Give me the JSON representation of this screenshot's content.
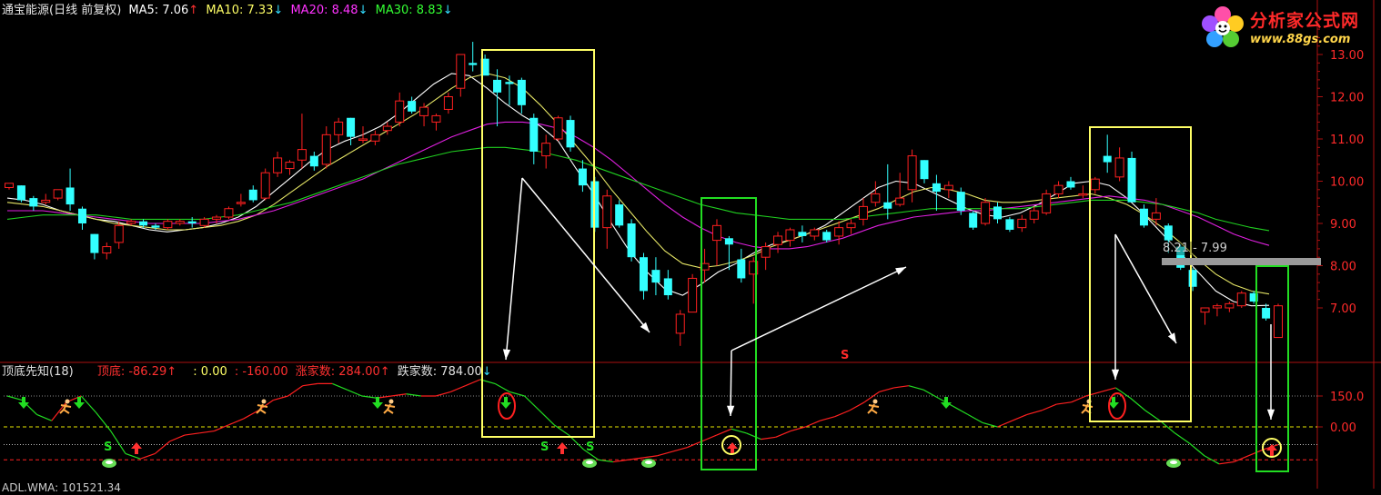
{
  "main_header": {
    "title": "通宝能源(日线 前复权)",
    "ma5": {
      "label": "MA5: 7.06",
      "arrow": "↑",
      "color": "#ffffff",
      "arrow_color": "#ff3030"
    },
    "ma10": {
      "label": "MA10: 7.33",
      "arrow": "↓",
      "color": "#ffff66",
      "arrow_color": "#33ddff"
    },
    "ma20": {
      "label": "MA20: 8.48",
      "arrow": "↓",
      "color": "#ff33ff",
      "arrow_color": "#33ddff"
    },
    "ma30": {
      "label": "MA30: 8.83",
      "arrow": "↓",
      "color": "#33ff33",
      "arrow_color": "#33ddff"
    }
  },
  "logo": {
    "name": "分析家公式网",
    "url": "www.88gs.com"
  },
  "sub_header": {
    "title": "顶底先知(18)",
    "dingdi": {
      "label": "顶底: -86.29",
      "arrow": "↑"
    },
    "v1": ": 0.00",
    "v2": ": -160.00",
    "zhang": {
      "label": "涨家数: 284.00",
      "arrow": "↑"
    },
    "die": {
      "label": "跌家数: 784.00",
      "arrow": "↓"
    }
  },
  "bottom_cut_text": "ADL.WMA: 101521.34",
  "zone_label": "8.21 - 7.99",
  "s_marker": "S",
  "colors": {
    "up": "#ff2020",
    "down": "#33ffff",
    "ma5": "#ffffff",
    "ma10": "#e6e666",
    "ma20": "#e020e0",
    "ma30": "#20d020",
    "yellow_box": "#ffff66",
    "green_box": "#22dd22",
    "axis": "#aa1111"
  },
  "chart_data": [
    {
      "type": "candlestick",
      "title": "通宝能源(日线 前复权)",
      "y_ticks": [
        "7.00",
        "8.00",
        "9.00",
        "10.00",
        "11.00",
        "12.00",
        "13.00"
      ],
      "ylim": [
        6.0,
        13.2
      ],
      "candles": [
        [
          9.85,
          9.95,
          9.8,
          9.95
        ],
        [
          9.9,
          9.9,
          9.5,
          9.55
        ],
        [
          9.6,
          9.65,
          9.3,
          9.4
        ],
        [
          9.5,
          9.7,
          9.45,
          9.55
        ],
        [
          9.6,
          9.8,
          9.55,
          9.8
        ],
        [
          9.85,
          10.3,
          9.3,
          9.45
        ],
        [
          9.35,
          9.4,
          8.85,
          9.0
        ],
        [
          8.75,
          8.75,
          8.15,
          8.3
        ],
        [
          8.3,
          8.55,
          8.15,
          8.45
        ],
        [
          8.55,
          9.05,
          8.4,
          8.95
        ],
        [
          9.0,
          9.1,
          8.95,
          9.05
        ],
        [
          9.05,
          9.1,
          8.9,
          8.95
        ],
        [
          8.95,
          9.0,
          8.85,
          8.9
        ],
        [
          8.9,
          9.1,
          8.85,
          9.05
        ],
        [
          9.0,
          9.1,
          8.95,
          9.05
        ],
        [
          9.05,
          9.15,
          8.9,
          9.0
        ],
        [
          8.95,
          9.15,
          8.9,
          9.1
        ],
        [
          9.1,
          9.2,
          9.0,
          9.15
        ],
        [
          9.15,
          9.4,
          9.1,
          9.35
        ],
        [
          9.5,
          9.7,
          9.4,
          9.5
        ],
        [
          9.8,
          9.9,
          9.5,
          9.55
        ],
        [
          9.6,
          10.3,
          9.55,
          10.2
        ],
        [
          10.2,
          10.7,
          10.1,
          10.55
        ],
        [
          10.3,
          10.5,
          10.15,
          10.45
        ],
        [
          10.5,
          11.6,
          10.3,
          10.75
        ],
        [
          10.6,
          10.7,
          10.25,
          10.35
        ],
        [
          10.4,
          11.3,
          10.3,
          11.1
        ],
        [
          11.1,
          11.5,
          10.9,
          11.4
        ],
        [
          11.5,
          11.5,
          10.85,
          11.05
        ],
        [
          11.0,
          11.3,
          10.9,
          11.0
        ],
        [
          10.95,
          11.2,
          10.85,
          11.1
        ],
        [
          11.2,
          11.4,
          11.1,
          11.3
        ],
        [
          11.4,
          12.1,
          11.3,
          11.9
        ],
        [
          11.9,
          12.0,
          11.6,
          11.65
        ],
        [
          11.55,
          11.85,
          11.3,
          11.75
        ],
        [
          11.4,
          11.6,
          11.2,
          11.55
        ],
        [
          11.7,
          12.1,
          11.6,
          12.0
        ],
        [
          12.2,
          13.0,
          12.0,
          13.0
        ],
        [
          12.8,
          13.3,
          12.6,
          12.75
        ],
        [
          12.9,
          13.0,
          12.7,
          12.5
        ],
        [
          12.4,
          12.65,
          11.3,
          12.1
        ],
        [
          12.35,
          12.5,
          11.8,
          12.3
        ],
        [
          12.4,
          12.45,
          11.6,
          11.8
        ],
        [
          11.5,
          11.6,
          10.4,
          10.7
        ],
        [
          10.6,
          11.1,
          10.3,
          10.9
        ],
        [
          11.0,
          11.55,
          10.95,
          11.5
        ],
        [
          11.45,
          11.55,
          10.7,
          10.8
        ],
        [
          10.3,
          10.5,
          9.75,
          9.9
        ],
        [
          10.0,
          10.1,
          8.8,
          8.9
        ],
        [
          8.9,
          9.8,
          8.4,
          9.65
        ],
        [
          9.45,
          9.55,
          8.9,
          8.95
        ],
        [
          9.0,
          9.1,
          8.1,
          8.2
        ],
        [
          8.2,
          8.3,
          7.2,
          7.4
        ],
        [
          7.9,
          8.2,
          7.3,
          7.6
        ],
        [
          7.7,
          7.9,
          7.2,
          7.3
        ],
        [
          6.4,
          6.95,
          6.1,
          6.85
        ],
        [
          6.9,
          7.8,
          6.9,
          7.7
        ],
        [
          7.9,
          8.4,
          7.6,
          8.05
        ],
        [
          8.6,
          9.1,
          8.0,
          8.95
        ],
        [
          8.65,
          8.7,
          7.9,
          8.5
        ],
        [
          8.15,
          8.4,
          7.6,
          7.7
        ],
        [
          7.8,
          8.2,
          7.1,
          8.1
        ],
        [
          8.2,
          8.55,
          7.9,
          8.45
        ],
        [
          8.5,
          8.8,
          8.3,
          8.7
        ],
        [
          8.6,
          8.9,
          8.45,
          8.85
        ],
        [
          8.8,
          8.95,
          8.55,
          8.7
        ],
        [
          8.7,
          8.9,
          8.6,
          8.85
        ],
        [
          8.8,
          8.85,
          8.55,
          8.6
        ],
        [
          8.7,
          9.05,
          8.5,
          8.9
        ],
        [
          8.9,
          9.1,
          8.75,
          9.0
        ],
        [
          9.1,
          9.6,
          8.95,
          9.4
        ],
        [
          9.5,
          10.0,
          9.4,
          9.7
        ],
        [
          9.5,
          10.4,
          9.1,
          9.35
        ],
        [
          9.45,
          10.2,
          9.4,
          9.6
        ],
        [
          9.8,
          10.75,
          9.5,
          10.6
        ],
        [
          10.5,
          10.5,
          9.95,
          10.05
        ],
        [
          9.95,
          10.15,
          9.3,
          9.75
        ],
        [
          9.8,
          10.0,
          9.6,
          9.9
        ],
        [
          9.75,
          9.85,
          9.2,
          9.3
        ],
        [
          9.25,
          9.3,
          8.85,
          8.9
        ],
        [
          9.0,
          9.6,
          8.95,
          9.5
        ],
        [
          9.4,
          9.5,
          9.0,
          9.1
        ],
        [
          9.1,
          9.15,
          8.8,
          8.85
        ],
        [
          8.9,
          9.2,
          8.8,
          9.1
        ],
        [
          9.1,
          9.4,
          9.0,
          9.3
        ],
        [
          9.25,
          9.8,
          9.2,
          9.7
        ],
        [
          9.7,
          10.0,
          9.6,
          9.9
        ],
        [
          10.0,
          10.1,
          9.8,
          9.85
        ],
        [
          9.7,
          9.9,
          9.6,
          9.7
        ],
        [
          9.8,
          10.1,
          9.7,
          10.05
        ],
        [
          10.6,
          11.1,
          10.2,
          10.45
        ],
        [
          10.1,
          10.8,
          10.0,
          10.55
        ],
        [
          10.55,
          10.7,
          9.6,
          9.5
        ],
        [
          9.35,
          9.45,
          8.9,
          8.95
        ],
        [
          9.1,
          9.6,
          8.95,
          9.25
        ],
        [
          8.95,
          9.0,
          8.3,
          8.6
        ],
        [
          8.45,
          8.5,
          7.9,
          7.95
        ],
        [
          7.9,
          7.95,
          7.4,
          7.5
        ],
        [
          6.9,
          7.0,
          6.6,
          7.0
        ],
        [
          7.0,
          7.1,
          6.8,
          7.05
        ],
        [
          7.0,
          7.15,
          6.9,
          7.1
        ],
        [
          7.05,
          7.4,
          7.0,
          7.35
        ],
        [
          7.35,
          7.4,
          7.1,
          7.15
        ],
        [
          7.0,
          7.1,
          6.7,
          6.75
        ],
        [
          6.3,
          7.1,
          6.3,
          7.05
        ]
      ],
      "ma": [
        {
          "name": "MA5",
          "values": [
            9.6,
            9.55,
            9.45,
            9.3,
            9.2,
            9.1,
            9.05,
            8.95,
            8.85,
            8.8,
            8.85,
            8.9,
            9.0,
            9.15,
            9.4,
            9.75,
            10.1,
            10.45,
            10.75,
            10.95,
            11.1,
            11.3,
            11.6,
            11.95,
            12.3,
            12.55,
            12.5,
            12.2,
            11.85,
            11.55,
            11.3,
            10.95,
            10.3,
            9.7,
            9.0,
            8.35,
            7.85,
            7.45,
            7.3,
            7.55,
            7.85,
            8.05,
            8.3,
            8.5,
            8.6,
            8.75,
            8.95,
            9.25,
            9.55,
            9.85,
            10.0,
            9.95,
            9.75,
            9.55,
            9.35,
            9.2,
            9.15,
            9.25,
            9.45,
            9.7,
            9.95,
            10.0,
            9.9,
            9.6,
            9.2,
            8.75,
            8.3,
            7.85,
            7.4,
            7.15,
            7.05,
            7.06
          ]
        },
        {
          "name": "MA10",
          "values": [
            9.5,
            9.45,
            9.4,
            9.3,
            9.2,
            9.1,
            9.0,
            8.95,
            8.9,
            8.85,
            8.85,
            8.9,
            8.95,
            9.05,
            9.2,
            9.45,
            9.75,
            10.05,
            10.35,
            10.6,
            10.85,
            11.1,
            11.35,
            11.6,
            11.9,
            12.2,
            12.45,
            12.55,
            12.45,
            12.2,
            11.8,
            11.35,
            10.85,
            10.35,
            9.8,
            9.3,
            8.8,
            8.35,
            8.05,
            7.95,
            8.0,
            8.1,
            8.25,
            8.45,
            8.6,
            8.75,
            8.9,
            9.05,
            9.2,
            9.35,
            9.55,
            9.75,
            9.85,
            9.8,
            9.7,
            9.55,
            9.5,
            9.5,
            9.55,
            9.6,
            9.65,
            9.7,
            9.6,
            9.45,
            9.2,
            8.9,
            8.55,
            8.15,
            7.8,
            7.55,
            7.4,
            7.33
          ]
        },
        {
          "name": "MA20",
          "values": [
            9.3,
            9.3,
            9.3,
            9.25,
            9.2,
            9.15,
            9.1,
            9.05,
            9.0,
            9.0,
            9.0,
            9.0,
            9.05,
            9.1,
            9.2,
            9.3,
            9.45,
            9.6,
            9.75,
            9.9,
            10.05,
            10.25,
            10.45,
            10.65,
            10.85,
            11.05,
            11.2,
            11.35,
            11.4,
            11.4,
            11.35,
            11.25,
            11.05,
            10.8,
            10.5,
            10.15,
            9.8,
            9.45,
            9.15,
            8.9,
            8.7,
            8.55,
            8.45,
            8.4,
            8.4,
            8.45,
            8.55,
            8.65,
            8.8,
            8.95,
            9.05,
            9.15,
            9.2,
            9.25,
            9.3,
            9.3,
            9.35,
            9.4,
            9.45,
            9.5,
            9.55,
            9.6,
            9.65,
            9.6,
            9.55,
            9.45,
            9.3,
            9.15,
            8.95,
            8.75,
            8.6,
            8.48
          ]
        },
        {
          "name": "MA30",
          "values": [
            9.1,
            9.15,
            9.2,
            9.2,
            9.2,
            9.2,
            9.15,
            9.1,
            9.1,
            9.1,
            9.1,
            9.1,
            9.15,
            9.2,
            9.3,
            9.4,
            9.5,
            9.65,
            9.8,
            9.95,
            10.1,
            10.25,
            10.4,
            10.5,
            10.6,
            10.7,
            10.75,
            10.8,
            10.8,
            10.75,
            10.7,
            10.6,
            10.5,
            10.35,
            10.2,
            10.05,
            9.9,
            9.75,
            9.6,
            9.45,
            9.35,
            9.25,
            9.2,
            9.15,
            9.1,
            9.1,
            9.1,
            9.1,
            9.15,
            9.2,
            9.25,
            9.3,
            9.35,
            9.35,
            9.35,
            9.35,
            9.35,
            9.35,
            9.4,
            9.45,
            9.5,
            9.55,
            9.55,
            9.55,
            9.5,
            9.45,
            9.35,
            9.25,
            9.1,
            9.0,
            8.9,
            8.83
          ]
        }
      ]
    },
    {
      "type": "line",
      "title": "顶底先知(18)",
      "y_ticks": [
        "150.0",
        "0.00"
      ],
      "ylim": [
        -200,
        240
      ],
      "reference_levels": [
        150,
        0,
        -86.29,
        -160
      ],
      "series": [
        {
          "name": "顶底",
          "values": [
            150,
            130,
            60,
            30,
            120,
            150,
            70,
            -20,
            -130,
            -155,
            -130,
            -70,
            -40,
            -30,
            -20,
            10,
            40,
            80,
            130,
            150,
            200,
            210,
            210,
            180,
            150,
            140,
            150,
            160,
            150,
            150,
            170,
            200,
            230,
            210,
            170,
            150,
            80,
            10,
            -40,
            -110,
            -160,
            -170,
            -160,
            -150,
            -140,
            -120,
            -100,
            -70,
            -40,
            -10,
            -30,
            -60,
            -50,
            -20,
            0,
            30,
            50,
            80,
            120,
            170,
            190,
            200,
            180,
            140,
            100,
            60,
            20,
            0,
            30,
            60,
            80,
            110,
            120,
            150,
            170,
            190,
            140,
            80,
            30,
            -30,
            -80,
            -140,
            -180,
            -170,
            -140,
            -110,
            -86.29
          ]
        }
      ]
    }
  ]
}
